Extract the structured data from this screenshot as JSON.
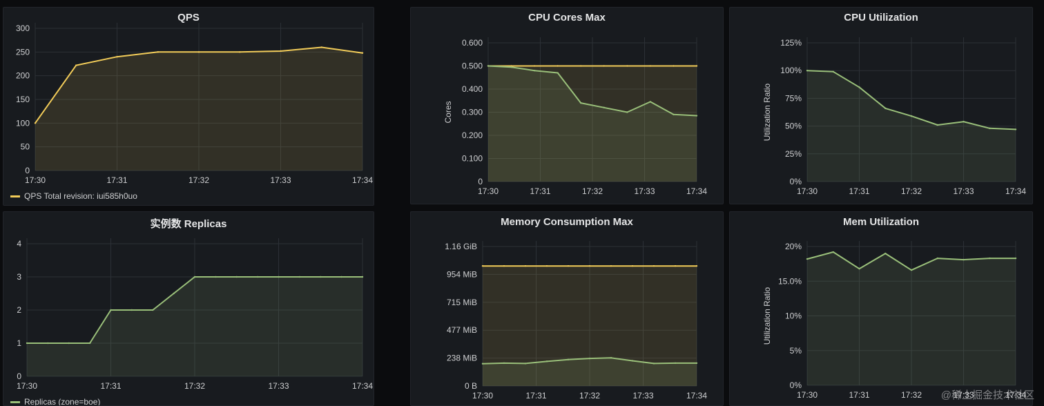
{
  "watermark": "@稀土掘金技术社区",
  "panels": {
    "qps": {
      "title": "QPS",
      "legend": "QPS Total revision: iui585h0uo"
    },
    "replicas": {
      "title": "实例数 Replicas",
      "legend": "Replicas (zone=boe)"
    },
    "cpu_cores": {
      "title": "CPU Cores Max"
    },
    "cpu_util": {
      "title": "CPU Utilization"
    },
    "memory": {
      "title": "Memory Consumption Max"
    },
    "mem_util": {
      "title": "Mem Utilization"
    }
  },
  "colors": {
    "yellow": "#f2cc59",
    "green": "#9ac07a",
    "grid": "#2c3036"
  },
  "chart_data": [
    {
      "id": "qps",
      "type": "area",
      "x": [
        "17:30",
        "17:30:30",
        "17:31",
        "17:31:30",
        "17:32",
        "17:32:30",
        "17:33",
        "17:33:30",
        "17:34"
      ],
      "xticks": [
        "17:30",
        "17:31",
        "17:32",
        "17:33",
        "17:34"
      ],
      "yticks": [
        "0",
        "50",
        "100",
        "150",
        "200",
        "250",
        "300"
      ],
      "ylim": [
        0,
        300
      ],
      "series": [
        {
          "name": "QPS Total revision: iui585h0uo",
          "color": "#f2cc59",
          "values": [
            100,
            222,
            240,
            250,
            250,
            250,
            252,
            260,
            248
          ]
        }
      ],
      "grid": true,
      "legend": "bottom-left"
    },
    {
      "id": "replicas",
      "type": "area",
      "x": [
        "17:30",
        "17:30:15",
        "17:30:30",
        "17:30:45",
        "17:31",
        "17:31:15",
        "17:31:30",
        "17:31:45",
        "17:32",
        "17:32:15",
        "17:32:30",
        "17:32:45",
        "17:33",
        "17:33:15",
        "17:33:30",
        "17:33:45",
        "17:34"
      ],
      "xticks": [
        "17:30",
        "17:31",
        "17:32",
        "17:33",
        "17:34"
      ],
      "yticks": [
        "0",
        "1",
        "2",
        "3",
        "4"
      ],
      "ylim": [
        0,
        4
      ],
      "series": [
        {
          "name": "Replicas (zone=boe)",
          "color": "#9ac07a",
          "values": [
            1,
            1,
            1,
            1,
            2,
            2,
            2,
            2.5,
            3,
            3,
            3,
            3,
            3,
            3,
            3,
            3,
            3
          ]
        }
      ],
      "grid": true,
      "legend": "bottom-left"
    },
    {
      "id": "cpu_cores",
      "type": "area",
      "x": [
        "17:30",
        "17:30:20",
        "17:30:40",
        "17:31",
        "17:31:30",
        "17:32",
        "17:32:30",
        "17:33",
        "17:33:30",
        "17:34"
      ],
      "xticks": [
        "17:30",
        "17:31",
        "17:32",
        "17:33",
        "17:34"
      ],
      "yticks": [
        "0",
        "0.100",
        "0.200",
        "0.300",
        "0.400",
        "0.500",
        "0.600"
      ],
      "ylim": [
        0,
        0.6
      ],
      "ylabel": "Cores",
      "series": [
        {
          "color": "#f2cc59",
          "values": [
            0.5,
            0.5,
            0.5,
            0.5,
            0.5,
            0.5,
            0.5,
            0.5,
            0.5,
            0.5
          ]
        },
        {
          "color": "#9ac07a",
          "values": [
            0.5,
            0.495,
            0.48,
            0.47,
            0.34,
            0.32,
            0.3,
            0.345,
            0.29,
            0.285
          ]
        }
      ],
      "grid": true
    },
    {
      "id": "cpu_util",
      "type": "area",
      "x": [
        "17:30",
        "17:30:30",
        "17:31",
        "17:31:30",
        "17:32",
        "17:32:30",
        "17:33",
        "17:33:30",
        "17:34"
      ],
      "xticks": [
        "17:30",
        "17:31",
        "17:32",
        "17:33",
        "17:34"
      ],
      "yticks": [
        "0%",
        "25%",
        "50%",
        "75%",
        "100%",
        "125%"
      ],
      "ylim": [
        0,
        125
      ],
      "ylabel": "Utilization Ratio",
      "series": [
        {
          "color": "#9ac07a",
          "values": [
            100,
            99,
            85,
            66,
            59,
            51,
            54,
            48,
            47
          ]
        }
      ],
      "grid": true
    },
    {
      "id": "memory",
      "type": "area",
      "x": [
        "17:30",
        "17:30:15",
        "17:30:30",
        "17:31",
        "17:31:30",
        "17:32",
        "17:32:30",
        "17:32:45",
        "17:33",
        "17:33:30",
        "17:34"
      ],
      "xticks": [
        "17:30",
        "17:31",
        "17:32",
        "17:33",
        "17:34"
      ],
      "yticks": [
        "0 B",
        "238 MiB",
        "477 MiB",
        "715 MiB",
        "954 MiB",
        "1.16 GiB"
      ],
      "ylim": [
        0,
        1190
      ],
      "series": [
        {
          "color": "#f2cc59",
          "values": [
            1024,
            1024,
            1024,
            1024,
            1024,
            1024,
            1024,
            1024,
            1024,
            1024,
            1024
          ]
        },
        {
          "color": "#9ac07a",
          "values": [
            190,
            195,
            192,
            210,
            225,
            235,
            240,
            215,
            192,
            195,
            195
          ]
        }
      ],
      "grid": true
    },
    {
      "id": "mem_util",
      "type": "area",
      "x": [
        "17:30",
        "17:30:30",
        "17:31",
        "17:31:30",
        "17:32",
        "17:32:30",
        "17:33",
        "17:33:30",
        "17:34"
      ],
      "xticks": [
        "17:30",
        "17:31",
        "17:32",
        "17:33",
        "17:34"
      ],
      "yticks": [
        "0%",
        "5%",
        "10%",
        "15.0%",
        "20%"
      ],
      "ylim": [
        0,
        20
      ],
      "ylabel": "Utilization Ratio",
      "series": [
        {
          "color": "#9ac07a",
          "values": [
            18.2,
            19.2,
            16.8,
            19,
            16.6,
            18.3,
            18.1,
            18.3,
            18.3
          ]
        }
      ],
      "grid": true
    }
  ]
}
